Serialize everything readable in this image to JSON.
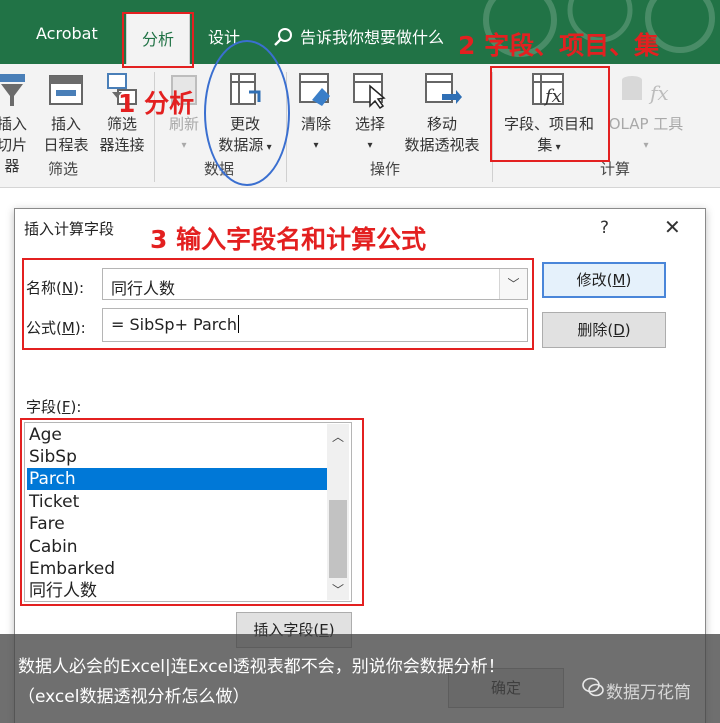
{
  "tabs": {
    "acrobat": "Acrobat",
    "analyze": "分析",
    "design": "设计",
    "tell_me": "告诉我你想要做什么"
  },
  "ribbon": {
    "insert_slicer": "插入\n切片器",
    "insert_slicer_l1": "插入",
    "insert_slicer_l2": "切片器",
    "insert_timeline_l1": "插入",
    "insert_timeline_l2": "日程表",
    "filter_conn_l1": "筛选",
    "filter_conn_l2": "器连接",
    "group_filter": "筛选",
    "refresh": "刷新",
    "change_source_l1": "更改",
    "change_source_l2": "数据源",
    "group_data": "数据",
    "clear": "清除",
    "select": "选择",
    "move_l1": "移动",
    "move_l2": "数据透视表",
    "group_actions": "操作",
    "fields_items_l1": "字段、项目和",
    "fields_items_l2": "集",
    "olap_tools": "OLAP 工具",
    "group_calc": "计算"
  },
  "annotations": {
    "step1": "1 分析",
    "step2": "2 字段、项目、集",
    "step3": "3 输入字段名和计算公式"
  },
  "dialog": {
    "title": "插入计算字段",
    "help": "?",
    "close": "✕",
    "name_label": "名称(",
    "name_key": "N",
    "name_label_end": "):",
    "name_value": "同行人数",
    "formula_label": "公式(",
    "formula_key": "M",
    "formula_label_end": "):",
    "formula_value": "= SibSp+ Parch",
    "modify_btn": "修改(",
    "modify_key": "M",
    "modify_end": ")",
    "delete_btn": "删除(",
    "delete_key": "D",
    "delete_end": ")",
    "fields_label": "字段(",
    "fields_key": "F",
    "fields_label_end": "):",
    "fields": [
      "Age",
      "SibSp",
      "Parch",
      "Ticket",
      "Fare",
      "Cabin",
      "Embarked",
      "同行人数"
    ],
    "selected_field": "Parch",
    "insert_field_btn": "插入字段(",
    "insert_field_key": "E",
    "insert_field_end": ")",
    "ok_btn": "确定"
  },
  "caption": {
    "line1": "数据人必会的Excel|连Excel透视表都不会，别说你会数据分析！",
    "line2": "（excel数据透视分析怎么做）",
    "watermark": "数据万花筒"
  },
  "colors": {
    "excel_green": "#217346",
    "annotation_red": "#e32020",
    "selection_blue": "#0078d7",
    "oval_blue": "#3a6fd0"
  }
}
